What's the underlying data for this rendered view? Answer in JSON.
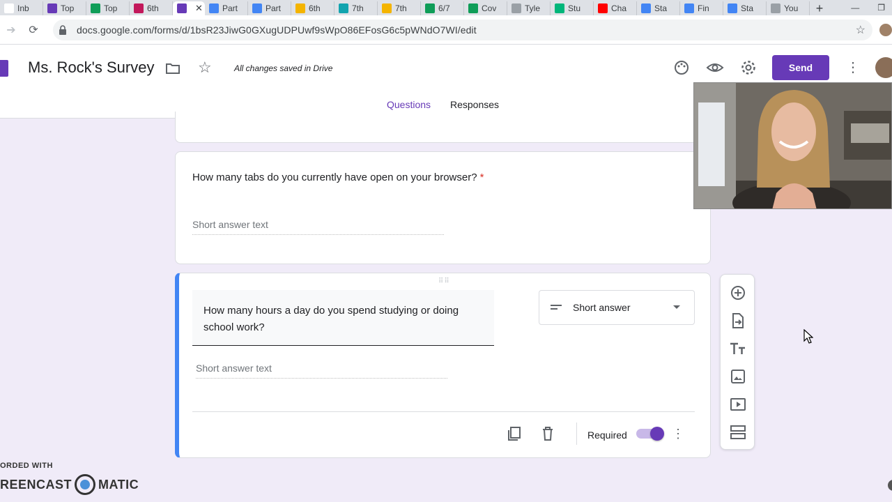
{
  "browser": {
    "tabs": [
      {
        "label": "Inb",
        "color": "#ffffff"
      },
      {
        "label": "Top",
        "color": "#673ab7"
      },
      {
        "label": "Top",
        "color": "#0f9d58"
      },
      {
        "label": "6th",
        "color": "#c2185b"
      },
      {
        "label": "",
        "color": "#673ab7",
        "active": true
      },
      {
        "label": "Part",
        "color": "#4285f4"
      },
      {
        "label": "Part",
        "color": "#4285f4"
      },
      {
        "label": "6th",
        "color": "#f4b400"
      },
      {
        "label": "7th",
        "color": "#12a4af"
      },
      {
        "label": "7th",
        "color": "#f4b400"
      },
      {
        "label": "6/7",
        "color": "#0f9d58"
      },
      {
        "label": "Cov",
        "color": "#0f9d58"
      },
      {
        "label": "Tyle",
        "color": "#9aa0a6"
      },
      {
        "label": "Stu",
        "color": "#00b67a"
      },
      {
        "label": "Cha",
        "color": "#ff0000"
      },
      {
        "label": "Sta",
        "color": "#4285f4"
      },
      {
        "label": "Fin",
        "color": "#4285f4"
      },
      {
        "label": "Sta",
        "color": "#4285f4"
      },
      {
        "label": "You",
        "color": "#9aa0a6"
      }
    ],
    "active_tab_close": "✕",
    "new_tab": "+",
    "url": "docs.google.com/forms/d/1bsR23JiwG0GXugUDPUwf9sWpO86EFosG6c5pWNdO7WI/edit"
  },
  "header": {
    "title": "Ms. Rock's Survey",
    "saved_status": "All changes saved in Drive",
    "send_label": "Send",
    "accent": "#673ab7"
  },
  "form_tabs": {
    "questions": "Questions",
    "responses": "Responses"
  },
  "questions": [
    {
      "text": "How many tabs do you currently have open on your browser?",
      "required_marker": "*",
      "answer_placeholder": "Short answer text"
    },
    {
      "text": "How many hours a day do you spend studying or doing school work?",
      "type_label": "Short answer",
      "answer_placeholder": "Short answer text",
      "required_label": "Required",
      "required": true
    }
  ],
  "watermark": {
    "line1": "ORDED WITH",
    "line2_left": "REENCAST",
    "line2_right": "MATIC"
  }
}
